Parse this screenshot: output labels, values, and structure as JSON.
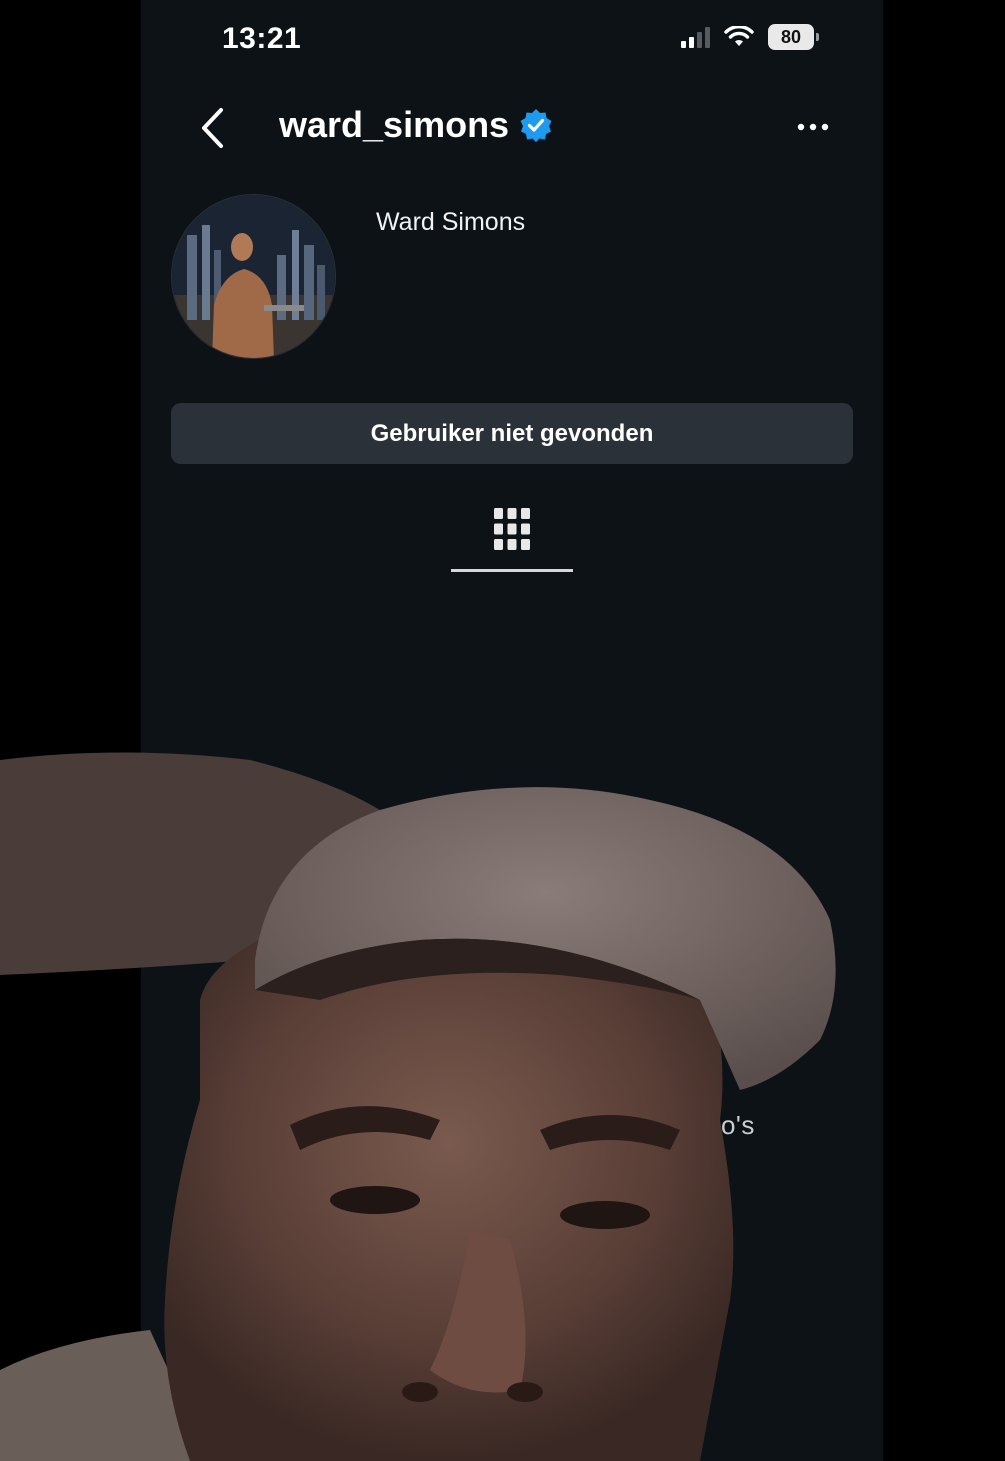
{
  "status_bar": {
    "time": "13:21",
    "battery": "80"
  },
  "header": {
    "username": "ward_simons",
    "back_icon": "chevron-left-icon",
    "verified_icon": "verified-badge-icon",
    "more_icon": "more-horizontal-icon"
  },
  "profile": {
    "display_name": "Ward Simons",
    "status_button": "Gebruiker niet gevonden"
  },
  "tabs": {
    "grid_icon": "grid-icon"
  },
  "content": {
    "partial_text": "eo's"
  },
  "colors": {
    "background": "#0d1217",
    "button_bg": "#2b3138",
    "verified_blue": "#1d9bf0",
    "text": "#ffffff"
  }
}
